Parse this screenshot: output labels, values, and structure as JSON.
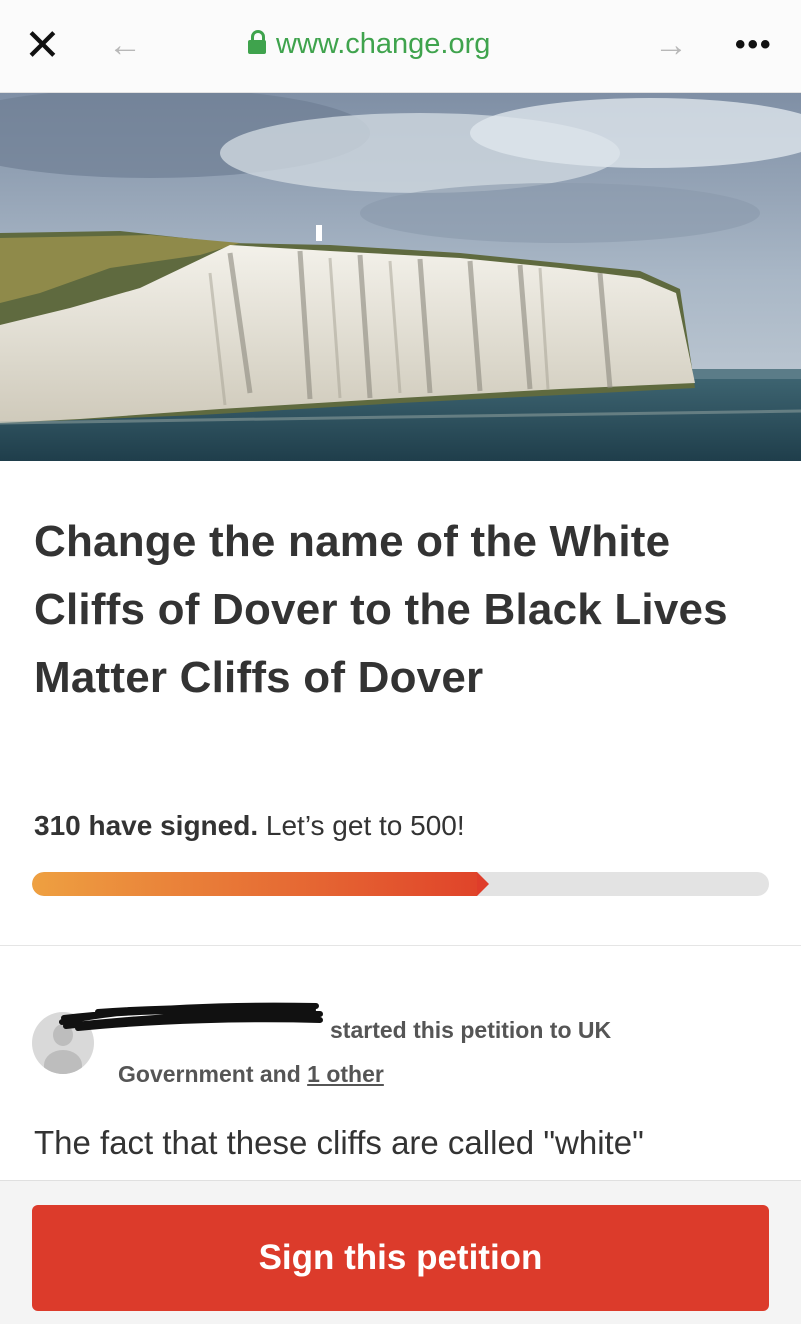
{
  "browser": {
    "close_icon": "close-icon",
    "back_icon": "arrow-left-icon",
    "forward_icon": "arrow-right-icon",
    "more_icon": "more-dots-icon",
    "url": "www.change.org",
    "lock_icon": "lock-icon",
    "url_color": "#3fa34d"
  },
  "petition": {
    "title": "Change the name of the White Cliffs of Dover to the Black Lives Matter Cliffs of Dover",
    "signed_count": "310 have signed.",
    "goal_text": "Let’s get to 500!",
    "progress_fraction": 0.62,
    "starter_suffix": "started this petition to UK Government and",
    "starter_other": "1 other",
    "excerpt": "The fact that these cliffs are called \"white\"",
    "sign_button": "Sign this petition"
  },
  "colors": {
    "accent_red": "#dc3b2b",
    "progress_start": "#eea041",
    "progress_end": "#e0442a"
  }
}
